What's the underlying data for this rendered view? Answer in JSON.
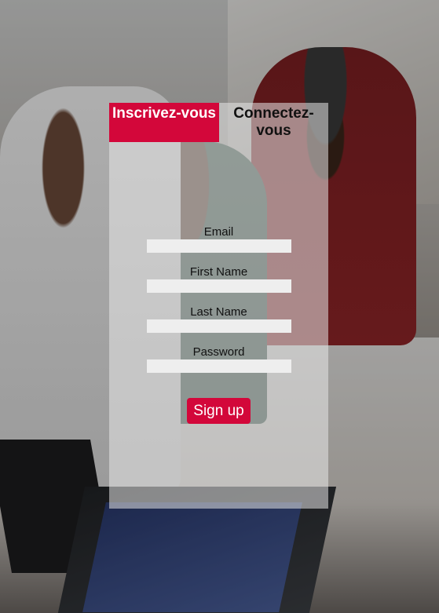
{
  "tabs": {
    "signup_label": "Inscrivez-vous",
    "login_label": "Connectez-vous"
  },
  "form": {
    "email_label": "Email",
    "email_value": "",
    "first_name_label": "First Name",
    "first_name_value": "",
    "last_name_label": "Last Name",
    "last_name_value": "",
    "password_label": "Password",
    "password_value": "",
    "submit_label": "Sign up"
  },
  "colors": {
    "accent": "#d3073a",
    "panel": "#e6e6e6",
    "input": "#eeeeee"
  },
  "background": {
    "image": "photo-people-at-computers"
  }
}
